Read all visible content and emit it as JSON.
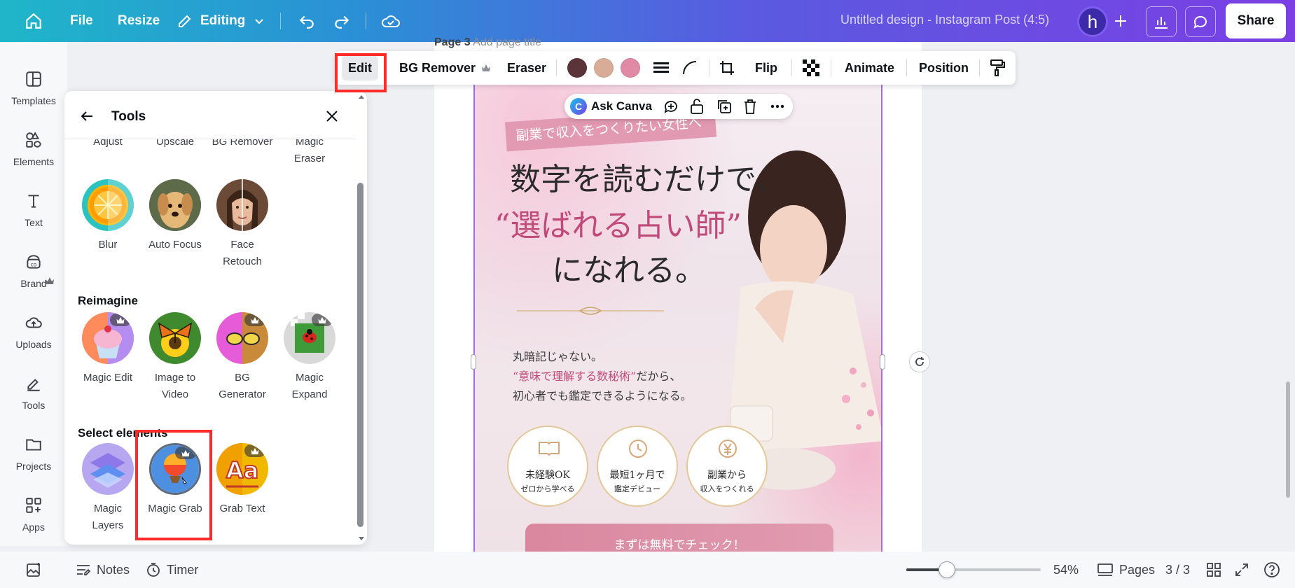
{
  "topbar": {
    "file_label": "File",
    "resize_label": "Resize",
    "mode_label": "Editing",
    "doc_title": "Untitled design - Instagram Post (4:5)",
    "avatar_letter": "h",
    "share_label": "Share"
  },
  "rail": {
    "items": [
      {
        "label": "Templates",
        "icon": "templates-icon"
      },
      {
        "label": "Elements",
        "icon": "elements-icon"
      },
      {
        "label": "Text",
        "icon": "text-icon"
      },
      {
        "label": "Brand",
        "icon": "brand-icon"
      },
      {
        "label": "Uploads",
        "icon": "uploads-icon"
      },
      {
        "label": "Tools",
        "icon": "tools-icon"
      },
      {
        "label": "Projects",
        "icon": "projects-icon"
      },
      {
        "label": "Apps",
        "icon": "apps-icon"
      }
    ]
  },
  "panel": {
    "title": "Tools",
    "cut_labels": [
      "Adjust",
      "Upscale",
      "BG Remover",
      "Magic",
      "Eraser"
    ],
    "row1": [
      "Blur",
      "Auto Focus",
      "Face",
      "Retouch"
    ],
    "reimagine_heading": "Reimagine",
    "reimagine": [
      {
        "line1": "Magic Edit",
        "line2": ""
      },
      {
        "line1": "Image to",
        "line2": "Video"
      },
      {
        "line1": "BG",
        "line2": "Generator"
      },
      {
        "line1": "Magic",
        "line2": "Expand"
      }
    ],
    "select_heading": "Select elements",
    "select": [
      {
        "line1": "Magic",
        "line2": "Layers"
      },
      {
        "line1": "Magic Grab",
        "line2": ""
      },
      {
        "line1": "Grab Text",
        "line2": ""
      }
    ]
  },
  "page": {
    "label": "Page 3",
    "title_placeholder": "Add page title"
  },
  "ctx_toolbar": {
    "edit_label": "Edit",
    "bg_remover_label": "BG Remover",
    "eraser_label": "Eraser",
    "flip_label": "Flip",
    "animate_label": "Animate",
    "position_label": "Position",
    "swatches": [
      "#5a3438",
      "#d9ac98",
      "#e08aa6"
    ]
  },
  "ask_canva": {
    "label": "Ask Canva"
  },
  "design": {
    "banner": "副業で収入をつくりたい女性へ",
    "headline1": "数字を読むだけで、",
    "headline2": "“選ばれる占い師”",
    "headline3": "になれる。",
    "body1": "丸暗記じゃない。",
    "body2_pink": "“意味で理解する数秘術”",
    "body2_tail": "だから、",
    "body3": "初心者でも鑑定できるようになる。",
    "badges": [
      {
        "title": "未経験OK",
        "sub": "ゼロから学べる"
      },
      {
        "title": "最短1ヶ月で",
        "sub": "鑑定デビュー"
      },
      {
        "title": "副業から",
        "sub": "収入をつくれる"
      }
    ],
    "cta": "まずは無料でチェック！"
  },
  "bottombar": {
    "notes_label": "Notes",
    "timer_label": "Timer",
    "zoom": "54%",
    "zoom_fraction": 0.3,
    "pages_label": "Pages",
    "page_count": "3 / 3"
  }
}
